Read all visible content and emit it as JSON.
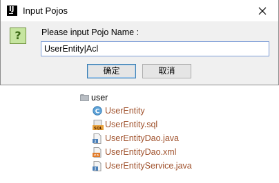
{
  "dialog": {
    "title": "Input Pojos",
    "prompt": "Please input Pojo Name :",
    "input_value": "UserEntity|Acl",
    "ok_label": "确定",
    "cancel_label": "取消",
    "colors": {
      "background": "#f0f0f0",
      "input_border": "#7a9bd6",
      "default_button_border": "#3c7fb1"
    },
    "icons": {
      "app": "intellij-idea-icon",
      "message": "question-icon",
      "close": "close-icon"
    }
  },
  "tree": {
    "folder": {
      "label": "user",
      "icon": "package-folder-icon"
    },
    "files": [
      {
        "label": "UserEntity",
        "icon": "java-class-icon"
      },
      {
        "label": "UserEntity.sql",
        "icon": "sql-file-icon"
      },
      {
        "label": "UserEntityDao.java",
        "icon": "java-file-icon"
      },
      {
        "label": "UserEntityDao.xml",
        "icon": "xml-file-icon"
      },
      {
        "label": "UserEntityService.java",
        "icon": "java-file-icon"
      }
    ],
    "colors": {
      "file_label": "#a0522d",
      "folder_label": "#000000"
    }
  }
}
